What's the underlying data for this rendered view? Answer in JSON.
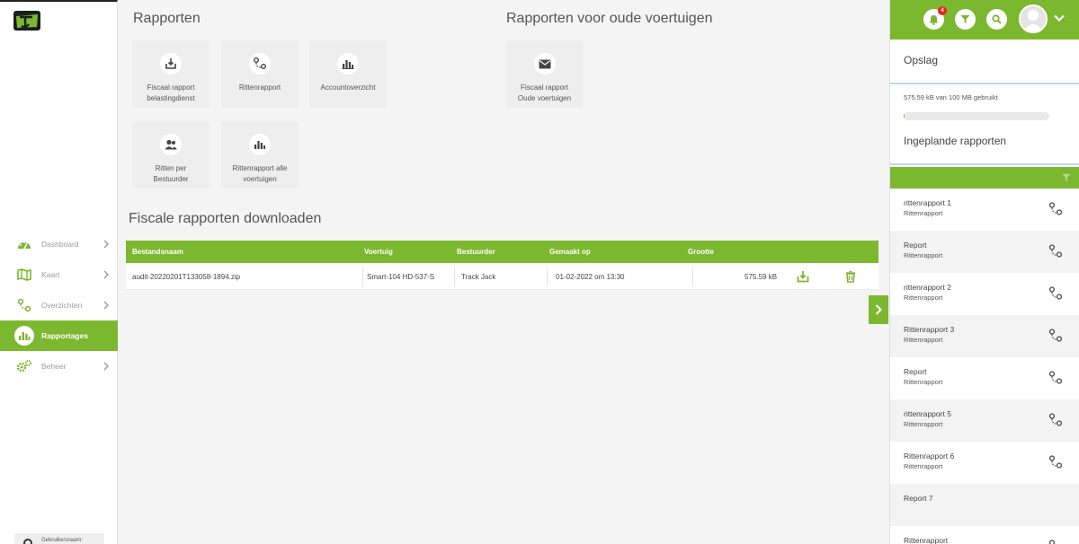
{
  "brand": {
    "accent": "#7cb82f",
    "badge_color": "#e2261c"
  },
  "sidebar": {
    "items": [
      {
        "label": "Dashboard",
        "icon": "dashboard-icon",
        "active": false
      },
      {
        "label": "Kaart",
        "icon": "map-icon",
        "active": false
      },
      {
        "label": "Overzichten",
        "icon": "route-icon",
        "active": false
      },
      {
        "label": "Rapportages",
        "icon": "bar-chart-icon",
        "active": true
      },
      {
        "label": "Beheer",
        "icon": "gears-icon",
        "active": false
      }
    ],
    "user_label": "Gebruikersnaam:"
  },
  "main": {
    "reports_title": "Rapporten",
    "old_vehicles_title": "Rapporten voor oude voertuigen",
    "tiles": [
      {
        "line1": "Fiscaal rapport",
        "line2": "belastingdienst",
        "icon": "download-icon"
      },
      {
        "line1": "Rittenrapport",
        "line2": "",
        "icon": "route-icon"
      },
      {
        "line1": "Accountoverzicht",
        "line2": "",
        "icon": "bar-chart-icon"
      },
      {
        "line1": "Ritten per",
        "line2": "Bestuurder",
        "icon": "users-icon"
      },
      {
        "line1": "Rittenrapport alle",
        "line2": "voertuigen",
        "icon": "bar-chart-icon"
      }
    ],
    "old_tile": {
      "line1": "Fiscaal rapport",
      "line2": "Oude voertuigen",
      "icon": "envelope-icon"
    },
    "downloads_title": "Fiscale rapporten downloaden",
    "table": {
      "headers": {
        "file": "Bestandsnaam",
        "vehicle": "Voertuig",
        "driver": "Bestuurder",
        "created": "Gemaakt op",
        "size": "Grootte"
      },
      "rows": [
        {
          "file": "audit-20220201T133058-1894.zip",
          "vehicle": "Smart-104 HD-537-S",
          "driver": "Track Jack",
          "created": "01-02-2022 om 13:30",
          "size": "575.59 kB"
        }
      ]
    }
  },
  "right_panel": {
    "notifications_count": "4",
    "storage_title": "Opslag",
    "storage_usage": "575.59 kB van 100 MB gebruikt",
    "storage_fraction": 0.0056,
    "scheduled_title": "Ingeplande rapporten",
    "scheduled": [
      {
        "name": "rittenrapport 1",
        "type": "Rittenrapport",
        "icon": "route-icon"
      },
      {
        "name": "Report",
        "type": "Rittenrapport",
        "icon": "route-icon"
      },
      {
        "name": "rittenrapport 2",
        "type": "Rittenrapport",
        "icon": "route-icon"
      },
      {
        "name": "Rittenrapport 3",
        "type": "Rittenrapport",
        "icon": "route-icon"
      },
      {
        "name": "Report",
        "type": "Rittenrapport",
        "icon": "route-icon"
      },
      {
        "name": "rittenrapport 5",
        "type": "Rittenrapport",
        "icon": "route-icon"
      },
      {
        "name": "Rittenrapport 6",
        "type": "Rittenrapport",
        "icon": "route-icon"
      },
      {
        "name": "Report 7",
        "type": "",
        "icon": ""
      },
      {
        "name": "Rittenrapport",
        "type": "",
        "icon": "route-icon"
      }
    ]
  }
}
